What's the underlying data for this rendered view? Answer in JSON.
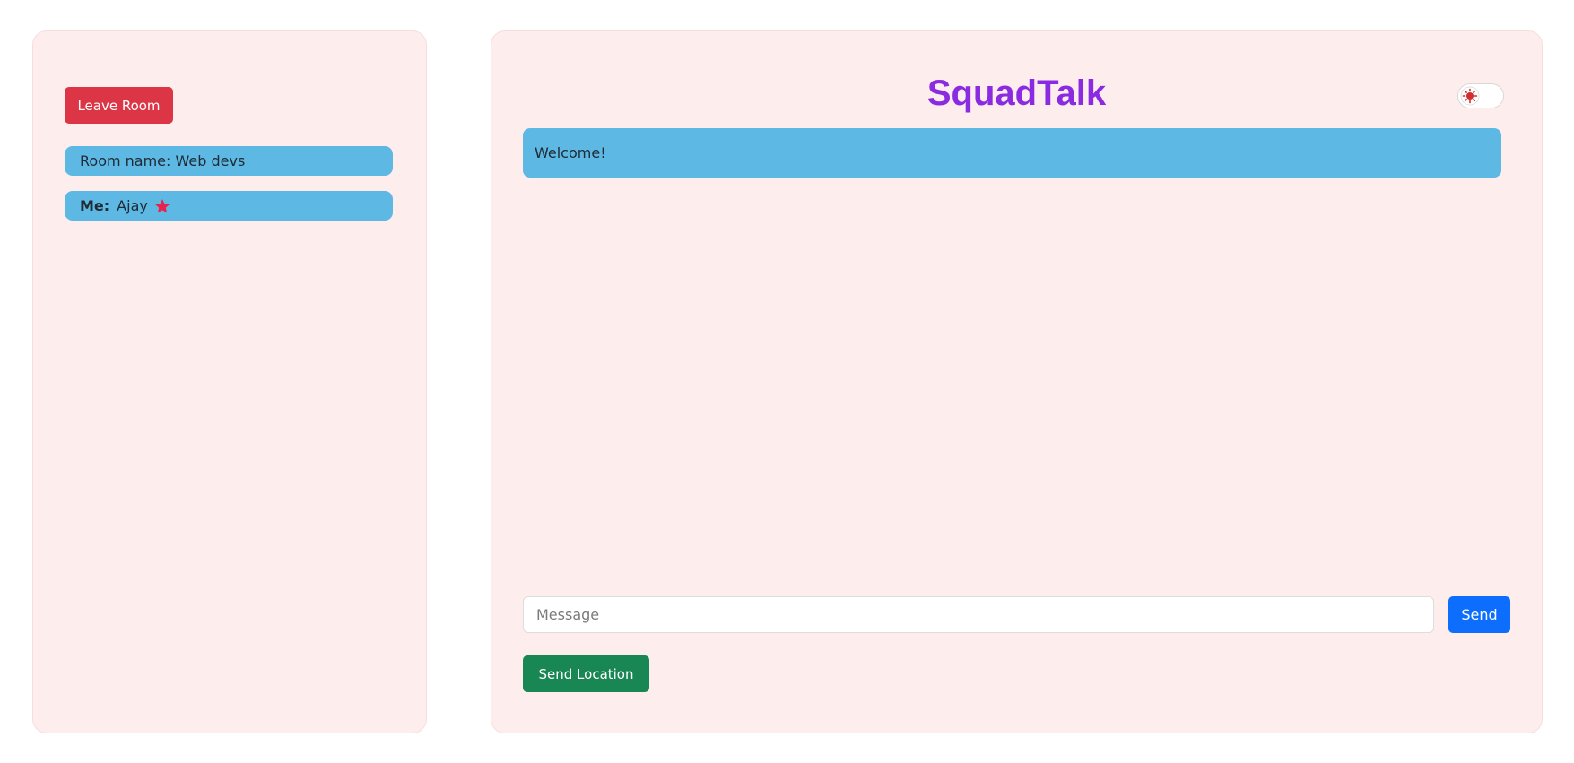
{
  "app": {
    "title": "SquadTalk"
  },
  "sidebar": {
    "leave_label": "Leave Room",
    "room_text": "Room name: Web devs",
    "me_label": "Me:",
    "me_name": "Ajay",
    "me_icon": "star-icon"
  },
  "chat": {
    "messages": [
      {
        "text": "Welcome!"
      }
    ]
  },
  "composer": {
    "placeholder": "Message",
    "value": "",
    "send_label": "Send",
    "location_label": "Send Location"
  },
  "theme_toggle": {
    "icon": "sun-icon",
    "state": "light"
  },
  "colors": {
    "brand": "#8a2be2",
    "danger": "#dc3545",
    "primary": "#0d6efd",
    "success": "#198754",
    "info_bubble": "#5db8e4",
    "panel_bg": "#fdeded",
    "star": "#e8224a"
  }
}
